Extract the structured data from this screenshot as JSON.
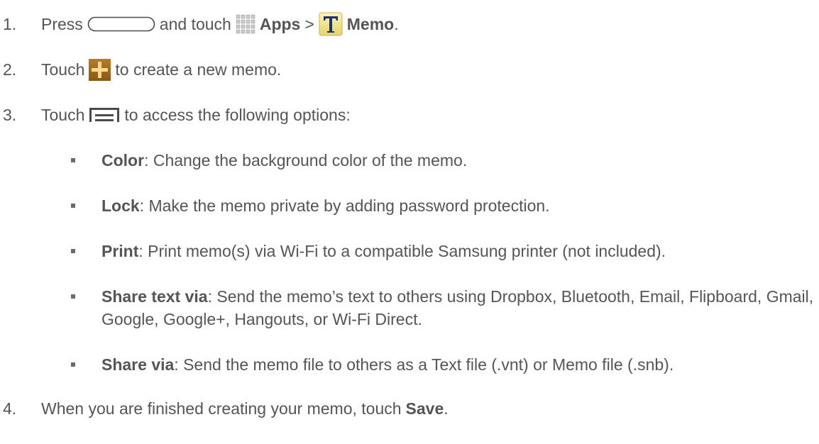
{
  "steps": [
    {
      "number": "1.",
      "press": "Press",
      "and_touch": "and touch",
      "apps": "Apps",
      "gt": ">",
      "memo": "Memo",
      "end": "."
    },
    {
      "number": "2.",
      "touch": "Touch",
      "rest": "to create a new memo."
    },
    {
      "number": "3.",
      "touch": "Touch",
      "rest": "to access the following options:"
    },
    {
      "number": "4.",
      "text": "When you are finished creating your memo, touch",
      "save": "Save",
      "end": "."
    }
  ],
  "options": [
    {
      "term": "Color",
      "desc": ": Change the background color of the memo."
    },
    {
      "term": "Lock",
      "desc": ": Make the memo private by adding password protection."
    },
    {
      "term": "Print",
      "desc": ": Print memo(s) via Wi-Fi to a compatible Samsung printer (not included)."
    },
    {
      "term": "Share text via",
      "desc": ": Send the memo’s text to others using Dropbox, Bluetooth, Email, Flipboard, Gmail, Google, Google+, Hangouts, or Wi-Fi Direct."
    },
    {
      "term": "Share via",
      "desc": ": Send the memo file to others as a Text file (.vnt) or Memo file (.snb)."
    }
  ],
  "icons": {
    "home_button": "home-button-icon",
    "apps": "apps-grid-icon",
    "memo": "memo-app-icon",
    "add": "add-plus-icon",
    "menu": "menu-icon"
  },
  "colors": {
    "text": "#555555",
    "memo_icon_bg": "#f3e89a",
    "memo_icon_letter": "#1b2f7a",
    "add_icon_bg": "#a06a1c",
    "add_icon_plus": "#f7d991"
  }
}
